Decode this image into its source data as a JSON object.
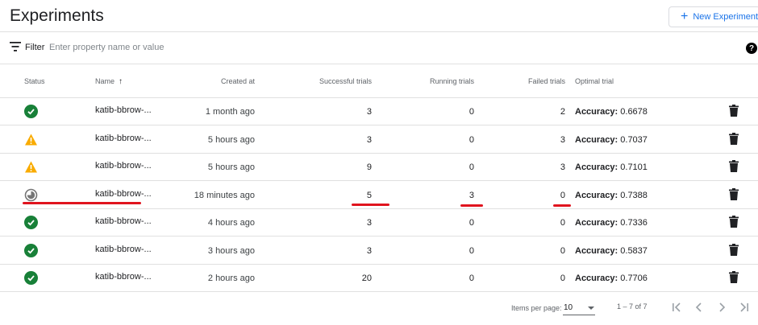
{
  "header": {
    "title": "Experiments",
    "new_button_label": "New Experiment"
  },
  "filter": {
    "label": "Filter",
    "placeholder": "Enter property name or value"
  },
  "columns": {
    "status": "Status",
    "name": "Name",
    "created": "Created at",
    "successful": "Successful trials",
    "running": "Running trials",
    "failed": "Failed trials",
    "optimal": "Optimal trial"
  },
  "sort": {
    "column": "name",
    "direction": "ascending"
  },
  "rows": [
    {
      "status": "succeeded",
      "name": "katib-bbrow-...",
      "created": "1 month ago",
      "successful": "3",
      "running": "0",
      "failed": "2",
      "metric": "Accuracy:",
      "value": "0.6678"
    },
    {
      "status": "warning",
      "name": "katib-bbrow-...",
      "created": "5 hours ago",
      "successful": "3",
      "running": "0",
      "failed": "3",
      "metric": "Accuracy:",
      "value": "0.7037"
    },
    {
      "status": "warning",
      "name": "katib-bbrow-...",
      "created": "5 hours ago",
      "successful": "9",
      "running": "0",
      "failed": "3",
      "metric": "Accuracy:",
      "value": "0.7101"
    },
    {
      "status": "running",
      "name": "katib-bbrow-...",
      "created": "18 minutes ago",
      "successful": "5",
      "running": "3",
      "failed": "0",
      "metric": "Accuracy:",
      "value": "0.7388"
    },
    {
      "status": "succeeded",
      "name": "katib-bbrow-...",
      "created": "4 hours ago",
      "successful": "3",
      "running": "0",
      "failed": "0",
      "metric": "Accuracy:",
      "value": "0.7336"
    },
    {
      "status": "succeeded",
      "name": "katib-bbrow-...",
      "created": "3 hours ago",
      "successful": "3",
      "running": "0",
      "failed": "0",
      "metric": "Accuracy:",
      "value": "0.5837"
    },
    {
      "status": "succeeded",
      "name": "katib-bbrow-...",
      "created": "2 hours ago",
      "successful": "20",
      "running": "0",
      "failed": "0",
      "metric": "Accuracy:",
      "value": "0.7706"
    }
  ],
  "paginator": {
    "items_per_page_label": "Items per page:",
    "items_per_page_value": "10",
    "range_label": "1 – 7 of 7"
  },
  "icons": {
    "filter": "filter-list-icon",
    "help": "help-icon",
    "status_succeeded": "check-circle-icon",
    "status_warning": "warning-icon",
    "status_running": "in-progress-icon",
    "delete": "trash-icon",
    "first_page": "first-page-icon",
    "prev_page": "chevron-left-icon",
    "next_page": "chevron-right-icon",
    "last_page": "last-page-icon"
  },
  "colors": {
    "accent": "#1a73e8",
    "success": "#188038",
    "warning": "#f9ab00",
    "annotation": "#e0141e"
  }
}
